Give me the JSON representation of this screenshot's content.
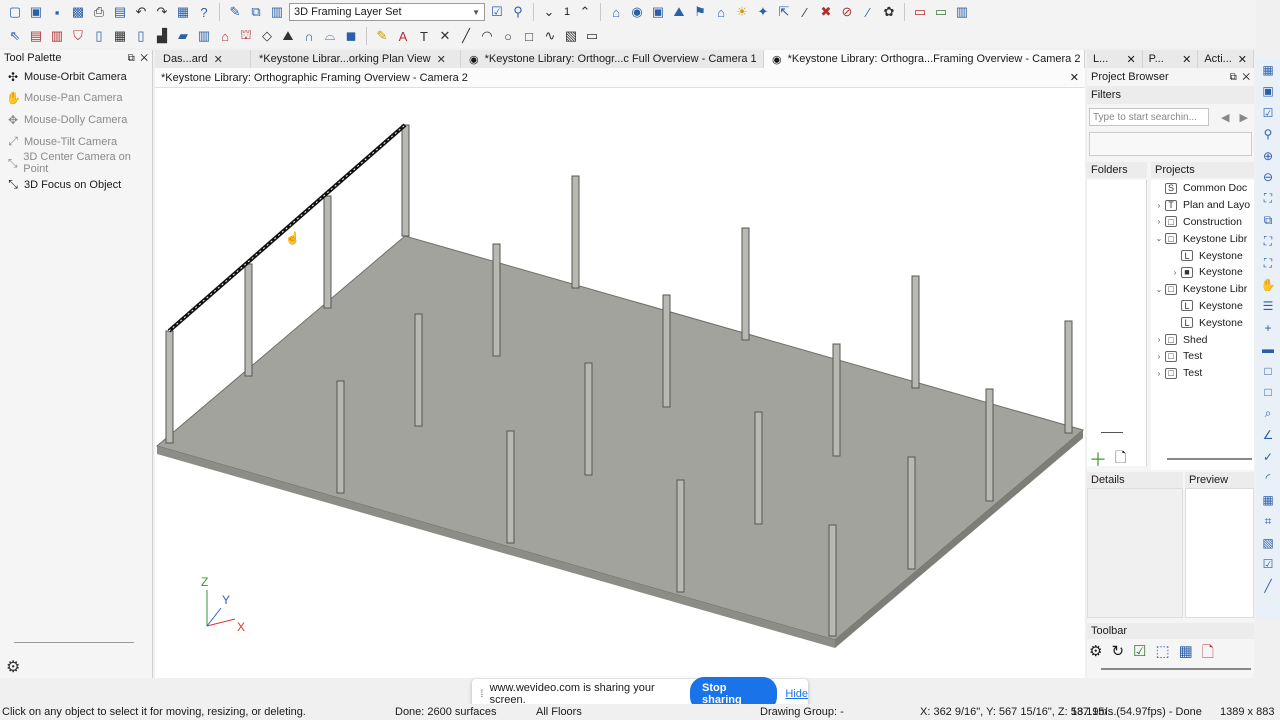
{
  "toolbar": {
    "layer_set": "3D Framing Layer Set",
    "floor_number": "1"
  },
  "palette": {
    "title": "Tool Palette",
    "items": [
      {
        "label": "Mouse-Orbit Camera",
        "enabled": true
      },
      {
        "label": "Mouse-Pan Camera",
        "enabled": false
      },
      {
        "label": "Mouse-Dolly Camera",
        "enabled": false
      },
      {
        "label": "Mouse-Tilt Camera",
        "enabled": false
      },
      {
        "label": "3D Center Camera on Point",
        "enabled": false
      },
      {
        "label": "3D Focus on Object",
        "enabled": true
      }
    ]
  },
  "tabs": [
    {
      "label": "Das...ard"
    },
    {
      "label": "*Keystone Librar...orking Plan View"
    },
    {
      "label": "*Keystone Library: Orthogr...c Full Overview - Camera 1"
    },
    {
      "label": "*Keystone Library: Orthogra...Framing Overview - Camera 2"
    }
  ],
  "view": {
    "title": "*Keystone Library: Orthographic Framing Overview - Camera 2",
    "axis": {
      "z": "Z",
      "y": "Y",
      "x": "X"
    }
  },
  "right_tabs": [
    {
      "label": "L..."
    },
    {
      "label": "P..."
    },
    {
      "label": "Acti..."
    }
  ],
  "project_browser": {
    "title": "Project Browser",
    "filters_label": "Filters",
    "search_placeholder": "Type to start searchin...",
    "folders_label": "Folders",
    "projects_label": "Projects",
    "tree": [
      {
        "label": "Common Doc",
        "level": 0,
        "exp": "",
        "icon": "S"
      },
      {
        "label": "Plan and Layo",
        "level": 0,
        "exp": "›",
        "icon": "T"
      },
      {
        "label": "Construction",
        "level": 0,
        "exp": "›",
        "icon": "□"
      },
      {
        "label": "Keystone Libr",
        "level": 0,
        "exp": "⌄",
        "icon": "□"
      },
      {
        "label": "Keystone",
        "level": 1,
        "exp": "",
        "icon": "L"
      },
      {
        "label": "Keystone",
        "level": 1,
        "exp": "›",
        "icon": "■"
      },
      {
        "label": "Keystone Libr",
        "level": 0,
        "exp": "⌄",
        "icon": "□"
      },
      {
        "label": "Keystone",
        "level": 1,
        "exp": "",
        "icon": "L"
      },
      {
        "label": "Keystone",
        "level": 1,
        "exp": "",
        "icon": "L"
      },
      {
        "label": "Shed",
        "level": 0,
        "exp": "›",
        "icon": "□"
      },
      {
        "label": "Test",
        "level": 0,
        "exp": "›",
        "icon": "□"
      },
      {
        "label": "Test",
        "level": 0,
        "exp": "›",
        "icon": "□"
      }
    ],
    "details_label": "Details",
    "preview_label": "Preview",
    "toolbar_label": "Toolbar"
  },
  "share_bar": {
    "message": "www.wevideo.com is sharing your screen.",
    "stop_label": "Stop sharing",
    "hide_label": "Hide"
  },
  "status": {
    "hint": "Click on any object to select it for moving, resizing, or deleting.",
    "done": "Done:  2600 surfaces",
    "floors": "All Floors",
    "drawing_group": "Drawing Group: -",
    "coords": "X: 362 9/16\", Y: 567 15/16\", Z: 537 15/...",
    "timing": "18.19ms (54.97fps) - Done",
    "size": "1389 x 883"
  }
}
